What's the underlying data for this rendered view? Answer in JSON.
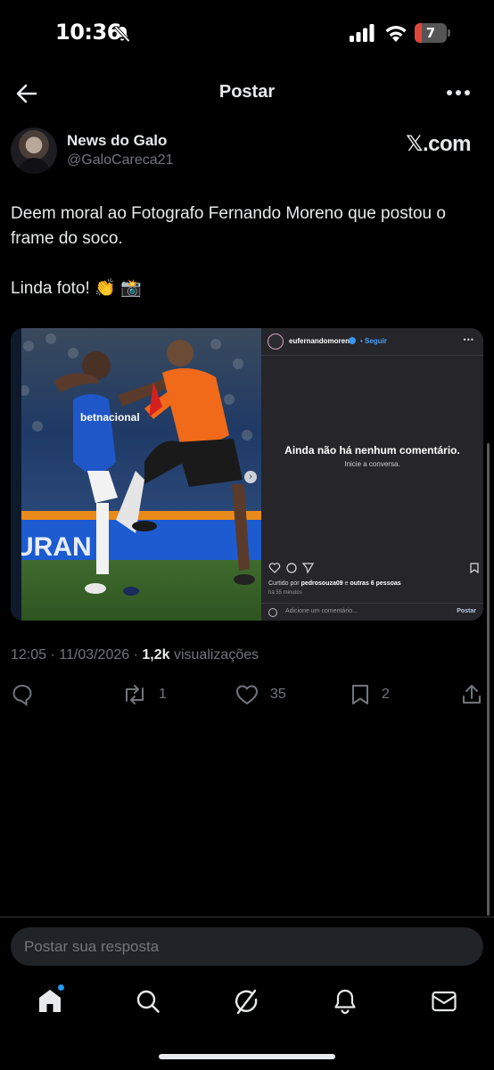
{
  "status_bar": {
    "time": "10:36",
    "battery_level": "7",
    "icons": [
      "bell-slash-icon",
      "signal-icon",
      "wifi-icon",
      "battery-icon"
    ]
  },
  "header": {
    "title": "Postar",
    "back_icon": "arrow-left-icon",
    "more_icon": "more-horizontal-icon"
  },
  "post": {
    "author_name": "News do Galo",
    "author_handle": "@GaloCareca21",
    "source_logo": "𝕏.com",
    "text_line1": "Deem moral ao Fotografo Fernando Moreno que postou o frame do soco.",
    "text_line2": "Linda foto! 👏 📸",
    "timestamp": "12:05 · 11/03/2026 · ",
    "views_count": "1,2k",
    "views_label": " visualizações"
  },
  "media": {
    "photo_sponsor": "betnacional",
    "photo_banner": "URAN",
    "instagram": {
      "username": "eufernandomoreno",
      "follow": "• Seguir",
      "empty_title": "Ainda não há nenhum comentário.",
      "empty_subtitle": "Inicie a conversa.",
      "liked_prefix": "Curtido por ",
      "liked_user": "pedrosouza09",
      "liked_mid": " e ",
      "liked_others": "outras 6 pessoas",
      "time_ago": "há 55 minutos",
      "comment_placeholder": "Adicione um comentário...",
      "post_button": "Postar"
    }
  },
  "actions": {
    "reply": {
      "icon": "reply-icon",
      "count": ""
    },
    "repost": {
      "icon": "repost-icon",
      "count": "1"
    },
    "like": {
      "icon": "heart-icon",
      "count": "35"
    },
    "bookmark": {
      "icon": "bookmark-icon",
      "count": "2"
    },
    "share": {
      "icon": "share-icon"
    }
  },
  "reply_box": {
    "placeholder": "Postar sua resposta"
  },
  "tab_bar": {
    "tabs": [
      "home-icon",
      "search-icon",
      "grok-icon",
      "notifications-icon",
      "messages-icon"
    ]
  },
  "colors": {
    "background": "#000000",
    "text_primary": "#e7e9ea",
    "text_secondary": "#71767b",
    "accent": "#1d9bf0"
  }
}
